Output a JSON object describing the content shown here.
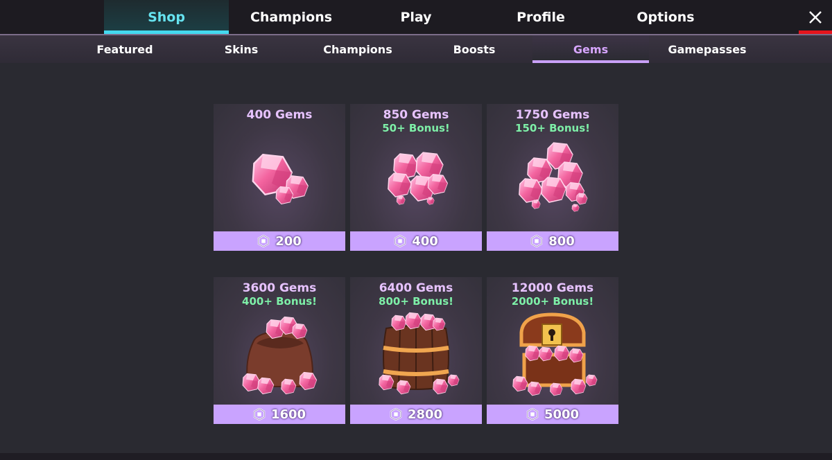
{
  "topnav": {
    "tabs": [
      {
        "label": "Shop",
        "active": true
      },
      {
        "label": "Champions",
        "active": false
      },
      {
        "label": "Play",
        "active": false
      },
      {
        "label": "Profile",
        "active": false
      },
      {
        "label": "Options",
        "active": false
      }
    ],
    "close_icon": "close-icon"
  },
  "subnav": {
    "tabs": [
      {
        "label": "Featured",
        "active": false
      },
      {
        "label": "Skins",
        "active": false
      },
      {
        "label": "Champions",
        "active": false
      },
      {
        "label": "Boosts",
        "active": false
      },
      {
        "label": "Gems",
        "active": true
      },
      {
        "label": "Gamepasses",
        "active": false
      }
    ]
  },
  "packs": [
    {
      "title": "400 Gems",
      "bonus": "",
      "price": "200",
      "art": "small-gem-cluster"
    },
    {
      "title": "850 Gems",
      "bonus": "50+ Bonus!",
      "price": "400",
      "art": "medium-gem-cluster"
    },
    {
      "title": "1750 Gems",
      "bonus": "150+ Bonus!",
      "price": "800",
      "art": "large-gem-cluster"
    },
    {
      "title": "3600 Gems",
      "bonus": "400+ Bonus!",
      "price": "1600",
      "art": "gem-sack"
    },
    {
      "title": "6400 Gems",
      "bonus": "800+ Bonus!",
      "price": "2800",
      "art": "gem-barrel"
    },
    {
      "title": "12000 Gems",
      "bonus": "2000+ Bonus!",
      "price": "5000",
      "art": "gem-treasure-chest"
    }
  ],
  "currency_icon": "robux-icon",
  "colors": {
    "active_tab_accent": "#44d9ef",
    "active_subtab_accent": "#c9a0f7",
    "close_accent": "#e5141c",
    "title_color": "#e7c3ff",
    "bonus_color": "#7ef0a8",
    "price_bar": "#c9a3ff"
  }
}
